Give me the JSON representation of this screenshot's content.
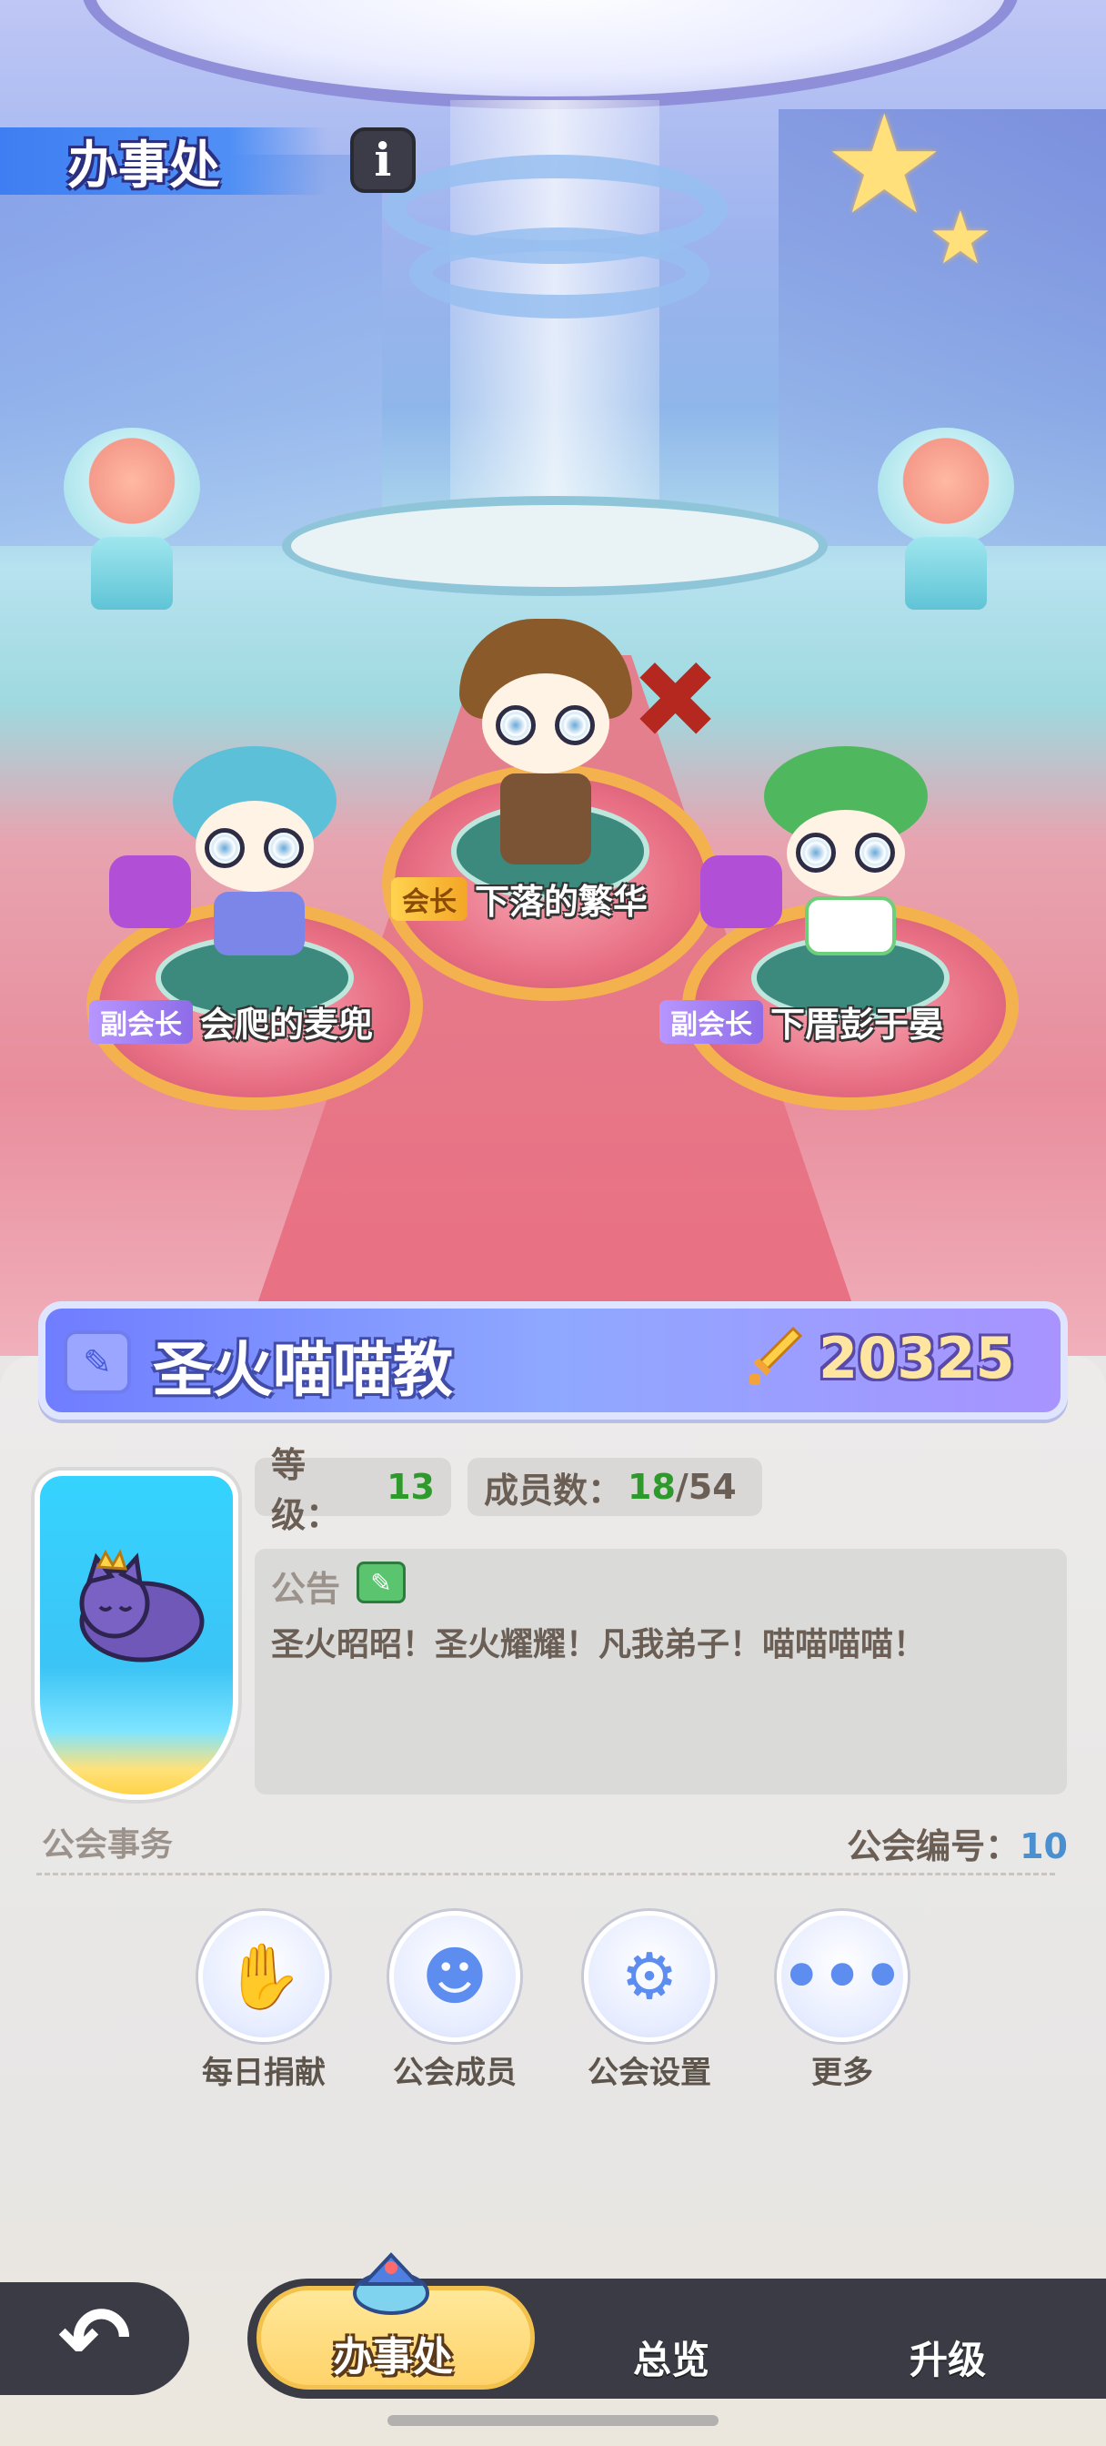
{
  "screen": {
    "title": "办事处",
    "info_icon": "info-icon"
  },
  "hall": {
    "leader": {
      "role": "会长",
      "name": "下落的繁华"
    },
    "vice_left": {
      "role": "副会长",
      "name": "会爬的麦兜"
    },
    "vice_right": {
      "role": "副会长",
      "name": "下厝彭于晏"
    }
  },
  "guild": {
    "name": "圣火喵喵教",
    "edit_icon": "pencil-icon",
    "power_icon": "sword-icon",
    "power": "20325",
    "level_label": "等级：",
    "level": "13",
    "members_label": "成员数：",
    "members_current": "18",
    "members_max": "/54",
    "notice_label": "公告",
    "notice_text": "圣火昭昭！圣火耀耀！凡我弟子！喵喵喵喵！",
    "affairs_label": "公会事务",
    "id_label": "公会编号：",
    "id": "10"
  },
  "actions": [
    {
      "label": "每日捐献",
      "icon": "donate-hand-icon"
    },
    {
      "label": "公会成员",
      "icon": "member-icon"
    },
    {
      "label": "公会设置",
      "icon": "gear-icon"
    },
    {
      "label": "更多",
      "icon": "more-dots-icon"
    }
  ],
  "tabs": [
    {
      "label": "办事处",
      "active": true
    },
    {
      "label": "总览",
      "active": false
    },
    {
      "label": "升级",
      "active": false
    }
  ],
  "colors": {
    "accent": "#6f7dff",
    "level_value": "#2f9a2c",
    "id_value": "#4a8fd0",
    "active_tab": "#ffd36a"
  }
}
